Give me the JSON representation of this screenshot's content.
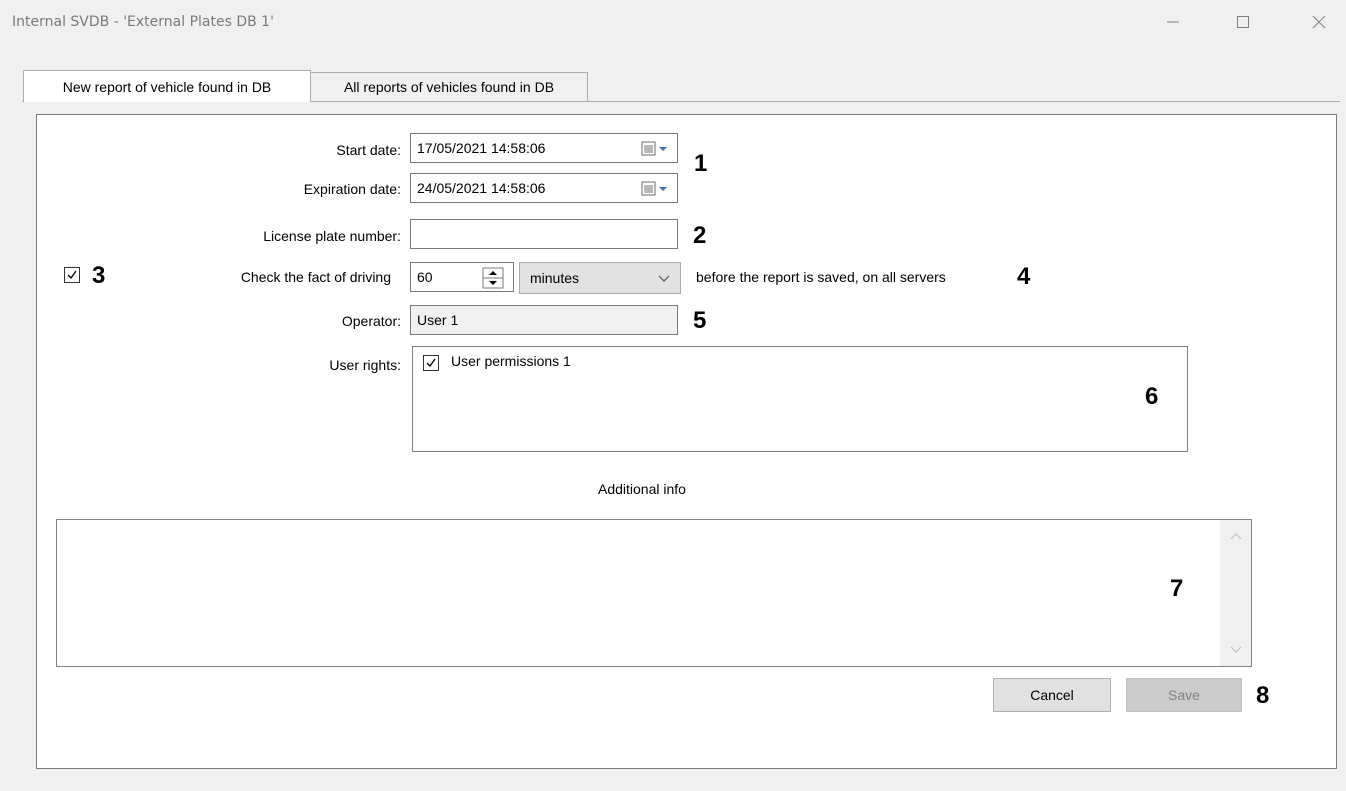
{
  "window": {
    "title": "Internal SVDB - 'External Plates DB 1'"
  },
  "tabs": [
    {
      "label": "New report of vehicle found in DB",
      "active": true
    },
    {
      "label": "All reports of vehicles found in DB",
      "active": false
    }
  ],
  "form": {
    "start_date": {
      "label": "Start date:",
      "value": "17/05/2021 14:58:06"
    },
    "expiration_date": {
      "label": "Expiration date:",
      "value": "24/05/2021 14:58:06"
    },
    "license_plate": {
      "label": "License plate number:",
      "value": ""
    },
    "check_driving": {
      "checked": true,
      "label": "Check the fact of driving",
      "value": "60",
      "unit": "minutes",
      "suffix": "before the report is saved, on all servers"
    },
    "operator": {
      "label": "Operator:",
      "value": "User 1"
    },
    "user_rights": {
      "label": "User rights:",
      "items": [
        {
          "label": "User permissions 1",
          "checked": true
        }
      ]
    },
    "additional_info": {
      "label": "Additional info",
      "value": ""
    }
  },
  "buttons": {
    "cancel": "Cancel",
    "save": "Save"
  },
  "callouts": [
    "1",
    "2",
    "3",
    "4",
    "5",
    "6",
    "7",
    "8"
  ],
  "icons": {
    "calendar": "calendar-dropdown-icon",
    "spin": "spin-updown-icon",
    "chevron": "chevron-down-icon"
  }
}
